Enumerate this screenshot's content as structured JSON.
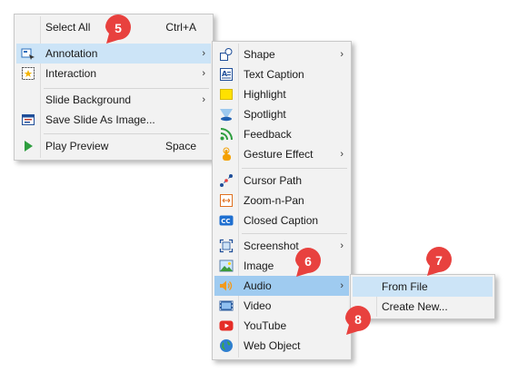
{
  "context_menu": {
    "items": [
      {
        "label": "Select All",
        "shortcut": "Ctrl+A"
      },
      {
        "label": "Annotation"
      },
      {
        "label": "Interaction"
      },
      {
        "label": "Slide Background"
      },
      {
        "label": "Save Slide As Image..."
      },
      {
        "label": "Play Preview",
        "shortcut": "Space"
      }
    ]
  },
  "annotation_menu": {
    "items": [
      {
        "label": "Shape"
      },
      {
        "label": "Text Caption"
      },
      {
        "label": "Highlight"
      },
      {
        "label": "Spotlight"
      },
      {
        "label": "Feedback"
      },
      {
        "label": "Gesture Effect"
      },
      {
        "label": "Cursor Path"
      },
      {
        "label": "Zoom-n-Pan"
      },
      {
        "label": "Closed Caption"
      },
      {
        "label": "Screenshot"
      },
      {
        "label": "Image"
      },
      {
        "label": "Audio"
      },
      {
        "label": "Video"
      },
      {
        "label": "YouTube"
      },
      {
        "label": "Web Object"
      }
    ]
  },
  "audio_menu": {
    "items": [
      {
        "label": "From File"
      },
      {
        "label": "Create New..."
      }
    ]
  },
  "callouts": [
    "5",
    "6",
    "7",
    "8"
  ],
  "submenu_arrow": "›",
  "colors": {
    "highlight": "#cce4f7",
    "highlight_strong": "#9fcbf0",
    "callout": "#e8413e"
  }
}
